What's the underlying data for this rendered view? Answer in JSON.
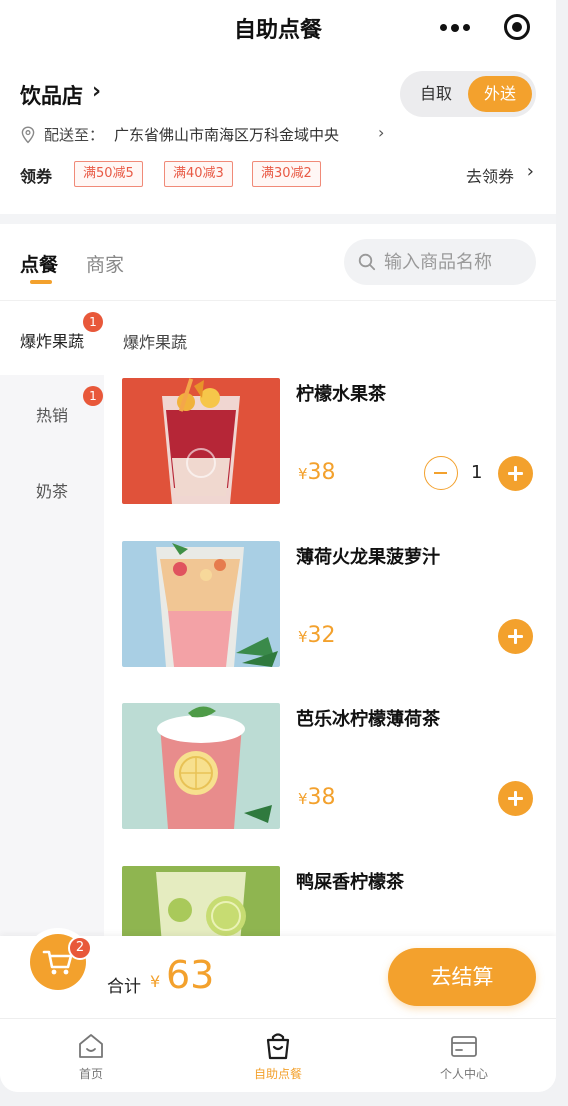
{
  "titlebar": {
    "title": "自助点餐"
  },
  "shop": {
    "name": "饮品店",
    "mode_pickup": "自取",
    "mode_delivery": "外送",
    "address_label": "配送至：",
    "address": "广东省佛山市南海区万科金域中央"
  },
  "coupons": {
    "label": "领券",
    "tags": [
      "满50减5",
      "满40减3",
      "满30减2"
    ],
    "get_label": "去领券"
  },
  "tabs": {
    "order": "点餐",
    "merchant": "商家"
  },
  "search": {
    "placeholder": "输入商品名称"
  },
  "categories": [
    {
      "label": "爆炸果蔬",
      "badge": "1",
      "active": true
    },
    {
      "label": "热销",
      "badge": "1",
      "active": false
    },
    {
      "label": "奶茶",
      "badge": "",
      "active": false
    }
  ],
  "section_title": "爆炸果蔬",
  "products": [
    {
      "name": "柠檬水果茶",
      "price_symbol": "¥",
      "price": "38",
      "quantity": "1",
      "bg": "#e0523a"
    },
    {
      "name": "薄荷火龙果菠萝汁",
      "price_symbol": "¥",
      "price": "32",
      "quantity": "",
      "bg": "#a9cfe4"
    },
    {
      "name": "芭乐冰柠檬薄荷茶",
      "price_symbol": "¥",
      "price": "38",
      "quantity": "",
      "bg": "#bcdcd4"
    },
    {
      "name": "鸭屎香柠檬茶",
      "price_symbol": "¥",
      "price": "",
      "quantity": "",
      "bg": "#8fb550"
    }
  ],
  "cart": {
    "count": "2",
    "total_label": "合计",
    "currency": "¥",
    "total": "63",
    "checkout_label": "去结算"
  },
  "tabbar": {
    "items": [
      {
        "label": "首页",
        "icon": "home-icon"
      },
      {
        "label": "自助点餐",
        "icon": "order-bag-icon"
      },
      {
        "label": "个人中心",
        "icon": "profile-card-icon"
      }
    ]
  },
  "colors": {
    "accent": "#f3a12d",
    "badge": "#e8583a",
    "coupon": "#e85a45"
  }
}
